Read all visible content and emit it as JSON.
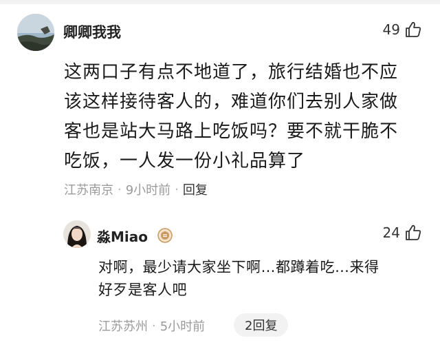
{
  "comment": {
    "username": "卿卿我我",
    "likes": "49",
    "text_lines": [
      "这两口子有点不地道了，旅行结婚也不应",
      "该这样接待客人的，难道你们去别人家做",
      "客也是站大马路上吃饭吗？要不就干脆不",
      "吃饭，一人发一份小礼品算了"
    ],
    "location": "江苏南京",
    "time": "9小时前",
    "reply_label": "回复",
    "separator": "·"
  },
  "reply": {
    "username": "淼Miao",
    "likes": "24",
    "text_lines": [
      "对啊，最少请大家坐下啊…都蹲着吃…来得",
      "好歹是客人吧"
    ],
    "location": "江苏苏州",
    "time": "5小时前",
    "replies_count_label": "2回复",
    "separator": "·"
  },
  "icons": {
    "like": "thumbs-up-icon",
    "badge": "level-badge-icon"
  },
  "colors": {
    "meta_gray": "#9a9a9a",
    "text": "#1a1a1a",
    "badge": "#c89a5e"
  }
}
